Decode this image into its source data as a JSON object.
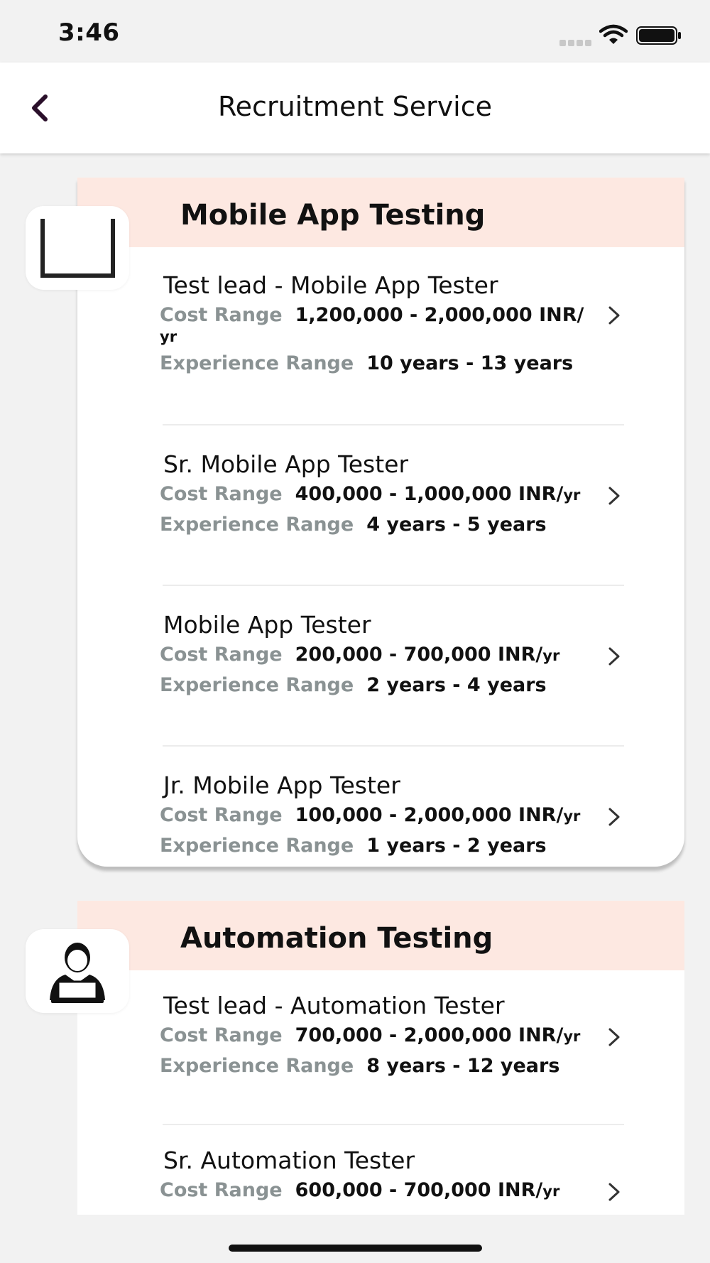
{
  "status_bar": {
    "time": "3:46"
  },
  "nav": {
    "title": "Recruitment Service",
    "back_icon": "chevron-left-icon"
  },
  "colors": {
    "accent": "#2a0f2a",
    "section_header_bg": "#fde8e1",
    "label_gray": "#8a9293"
  },
  "labels": {
    "cost": "Cost Range",
    "experience": "Experience Range",
    "unit": "yr",
    "wrap_unit": "yr"
  },
  "sections": [
    {
      "title": "Mobile App Testing",
      "icon": "placeholder-frame-icon",
      "jobs": [
        {
          "title": "Test lead - Mobile App Tester",
          "cost": "1,200,000 - 2,000,000 INR/",
          "experience": "10 years - 13 years"
        },
        {
          "title": "Sr. Mobile App Tester",
          "cost": "400,000 - 1,000,000 INR/",
          "experience": "4 years - 5 years"
        },
        {
          "title": "Mobile App Tester",
          "cost": "200,000 - 700,000 INR/",
          "experience": "2 years - 4 years"
        },
        {
          "title": "Jr. Mobile App Tester",
          "cost": "100,000 - 2,000,000 INR/",
          "experience": "1 years - 2 years"
        }
      ]
    },
    {
      "title": "Automation Testing",
      "icon": "person-laptop-icon",
      "jobs": [
        {
          "title": "Test lead - Automation Tester",
          "cost": "700,000 - 2,000,000 INR/",
          "experience": "8 years - 12 years"
        },
        {
          "title": "Sr. Automation Tester",
          "cost": "600,000 - 700,000 INR/"
        }
      ]
    }
  ]
}
